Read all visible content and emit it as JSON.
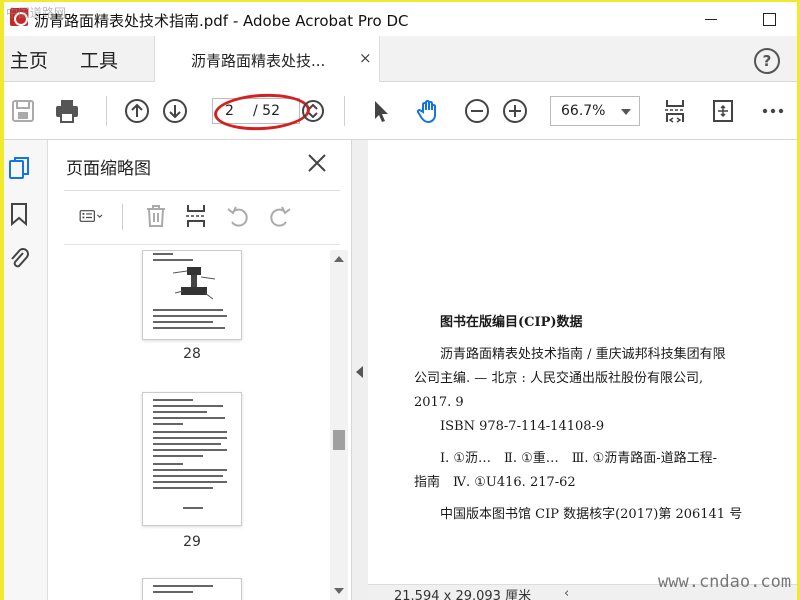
{
  "window": {
    "title": "沥青路面精表处技术指南.pdf - Adobe Acrobat Pro DC"
  },
  "nav": {
    "home": "主页",
    "tools": "工具",
    "doc_tab": "沥青路面精表处技...",
    "doc_tab_close": "×",
    "help": "?"
  },
  "toolbar": {
    "page_current": "2",
    "page_total": "/ 52",
    "zoom": "66.7%"
  },
  "thumbnails": {
    "title": "页面缩略图",
    "pages": [
      {
        "label": "28"
      },
      {
        "label": "29"
      }
    ]
  },
  "document": {
    "cip_heading": "图书在版编目(CIP)数据",
    "line1": "沥青路面精表处技术指南 / 重庆诚邦科技集团有限",
    "line2": "公司主编. — 北京 : 人民交通出版社股份有限公司,",
    "line3": "2017. 9",
    "isbn": "ISBN 978-7-114-14108-9",
    "class_line1": "Ⅰ. ①沥…　Ⅱ. ①重…　Ⅲ. ①沥青路面-道路工程-",
    "class_line2": "指南　Ⅳ. ①U416. 217-62",
    "library_line": "中国版本图书馆 CIP 数据核字(2017)第 206141 号"
  },
  "status": {
    "page_size": "21.594 x 29.093 厘米"
  },
  "watermarks": {
    "top": "中国道路网",
    "bottom": "www.cndao.com"
  },
  "colors": {
    "background_frame": "#f0ea2b",
    "annotation_red": "#d32020",
    "accent_blue": "#1473e6"
  },
  "icons": [
    "save-icon",
    "print-icon",
    "page-up-icon",
    "page-down-icon",
    "select-arrow-icon",
    "hand-tool-icon",
    "zoom-out-icon",
    "zoom-in-icon",
    "fit-page-icon",
    "scroll-mode-icon",
    "more-icon",
    "thumbnails-icon",
    "bookmark-icon",
    "attachment-icon",
    "options-icon",
    "delete-icon",
    "insert-icon",
    "rotate-left-icon",
    "rotate-right-icon"
  ]
}
